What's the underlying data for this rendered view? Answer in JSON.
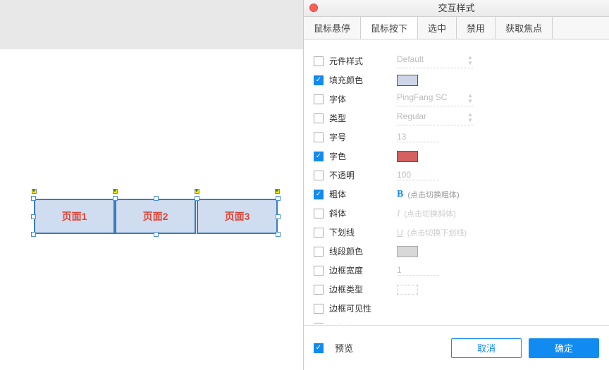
{
  "dialog": {
    "title": "交互样式",
    "tabs": [
      "鼠标悬停",
      "鼠标按下",
      "选中",
      "禁用",
      "获取焦点"
    ],
    "active_tab_index": 1,
    "preview_label": "预览",
    "preview_checked": true,
    "cancel_label": "取消",
    "ok_label": "确定"
  },
  "properties": [
    {
      "label": "元件样式",
      "checked": false,
      "type": "select",
      "value": "Default"
    },
    {
      "label": "填充颜色",
      "checked": true,
      "type": "swatch",
      "swatch_class": "fill"
    },
    {
      "label": "字体",
      "checked": false,
      "type": "select",
      "value": "PingFang SC"
    },
    {
      "label": "类型",
      "checked": false,
      "type": "select",
      "value": "Regular"
    },
    {
      "label": "字号",
      "checked": false,
      "type": "value",
      "value": "13"
    },
    {
      "label": "字色",
      "checked": true,
      "type": "swatch",
      "swatch_class": "red"
    },
    {
      "label": "不透明",
      "checked": false,
      "type": "value",
      "value": "100"
    },
    {
      "label": "粗体",
      "checked": true,
      "type": "bold",
      "hint": "(点击切换粗体)"
    },
    {
      "label": "斜体",
      "checked": false,
      "type": "italic",
      "hint": "(点击切换斜体)"
    },
    {
      "label": "下划线",
      "checked": false,
      "type": "underline",
      "hint": "(点击切换下划线)"
    },
    {
      "label": "线段颜色",
      "checked": false,
      "type": "swatch",
      "swatch_class": "grey"
    },
    {
      "label": "边框宽度",
      "checked": false,
      "type": "value",
      "value": "1"
    },
    {
      "label": "边框类型",
      "checked": false,
      "type": "dash"
    },
    {
      "label": "边框可见性",
      "checked": false,
      "type": "blank"
    },
    {
      "label": "圆角半径",
      "checked": false,
      "type": "value",
      "value": ""
    }
  ],
  "canvas": {
    "cells": [
      "页面1",
      "页面2",
      "页面3"
    ]
  }
}
